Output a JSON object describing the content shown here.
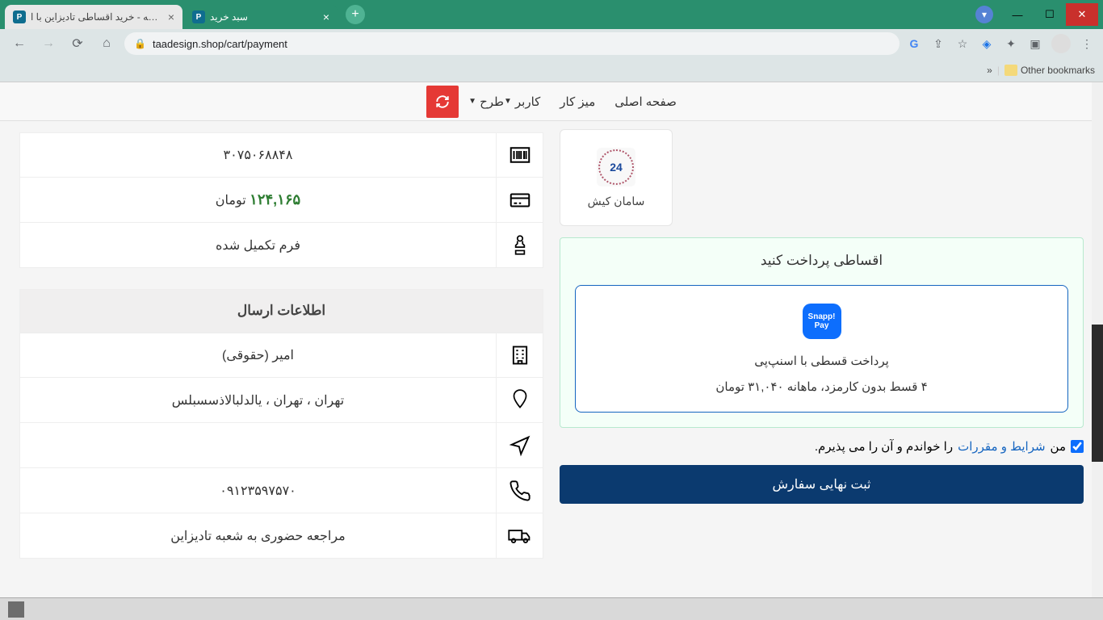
{
  "browser": {
    "tabs": [
      {
        "title": "ویرایش صفحه - خرید اقساطی تادیزاین با ا"
      },
      {
        "title": "سبد خرید"
      }
    ],
    "url": "taadesign.shop/cart/payment",
    "bookmarks": {
      "other": "Other bookmarks",
      "chevron": "»"
    }
  },
  "nav": {
    "home": "صفحه اصلی",
    "desk": "میز کار",
    "user": "کاربر",
    "plan": "طرح"
  },
  "order": {
    "code": "۳۰۷۵۰۶۸۸۴۸",
    "price_value": "۱۲۴,۱۶۵",
    "price_unit": "تومان",
    "form": "فرم تکمیل شده"
  },
  "shipping": {
    "title": "اطلاعات ارسال",
    "name": "امیر (حقوقی)",
    "address": "تهران ، تهران ، یالدلبالاذسسبلس",
    "phone": "۰۹۱۲۳۵۹۷۵۷۰",
    "delivery": "مراجعه حضوری به شعبه تادیزاین"
  },
  "gateway": {
    "logo_text": "24",
    "name": "سامان کیش"
  },
  "installment": {
    "title": "اقساطی پرداخت کنید",
    "logo": "Snapp! Pay",
    "desc": "پرداخت قسطی با اسنپ‌پی",
    "detail": "۴ قسط بدون کارمزد، ماهانه ۳۱,۰۴۰ تومان"
  },
  "terms": {
    "pre": "من",
    "link": "شرایط و مقررات",
    "post": "را خواندم و آن را می پذیرم."
  },
  "submit": "ثبت نهایی سفارش"
}
